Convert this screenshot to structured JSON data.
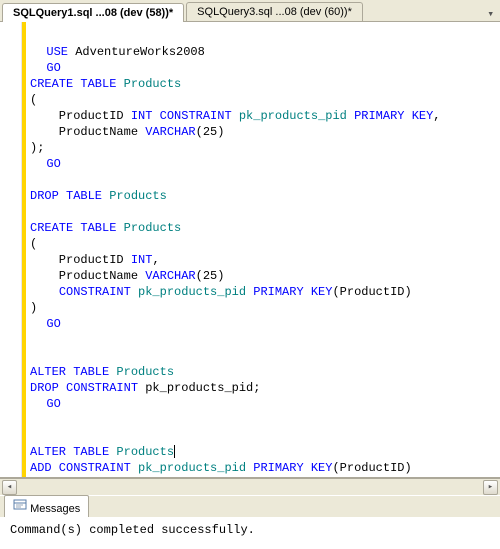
{
  "tabs": [
    {
      "label": "SQLQuery1.sql ...08 (dev (58))*"
    },
    {
      "label": "SQLQuery3.sql ...08 (dev (60))*"
    }
  ],
  "code": {
    "l1_use": "USE",
    "l1_db": " AdventureWorks2008",
    "go": "GO",
    "create_tbl": "CREATE TABLE",
    "products": " Products",
    "open_paren": "(",
    "c1_a": "    ProductID ",
    "int": "INT",
    "sp": " ",
    "constraint": "CONSTRAINT",
    "pkname": " pk_products_pid ",
    "primary_key": "PRIMARY KEY",
    "comma": ",",
    "c2_a": "    ProductName ",
    "varchar": "VARCHAR",
    "p25": "(25)",
    "close_paren_sc": ");",
    "drop_tbl": "DROP TABLE",
    "c3_a": "    ProductID ",
    "c4_a": "    ProductName ",
    "c5_a": "    ",
    "pk_pid_open": "(ProductID)",
    "close_paren": ")",
    "alter_tbl": "ALTER TABLE",
    "drop_constraint": "DROP CONSTRAINT",
    "pkname_sc": " pk_products_pid;",
    "add_constraint": "ADD CONSTRAINT"
  },
  "messages": {
    "tab_label": "Messages",
    "text": "Command(s) completed successfully."
  }
}
